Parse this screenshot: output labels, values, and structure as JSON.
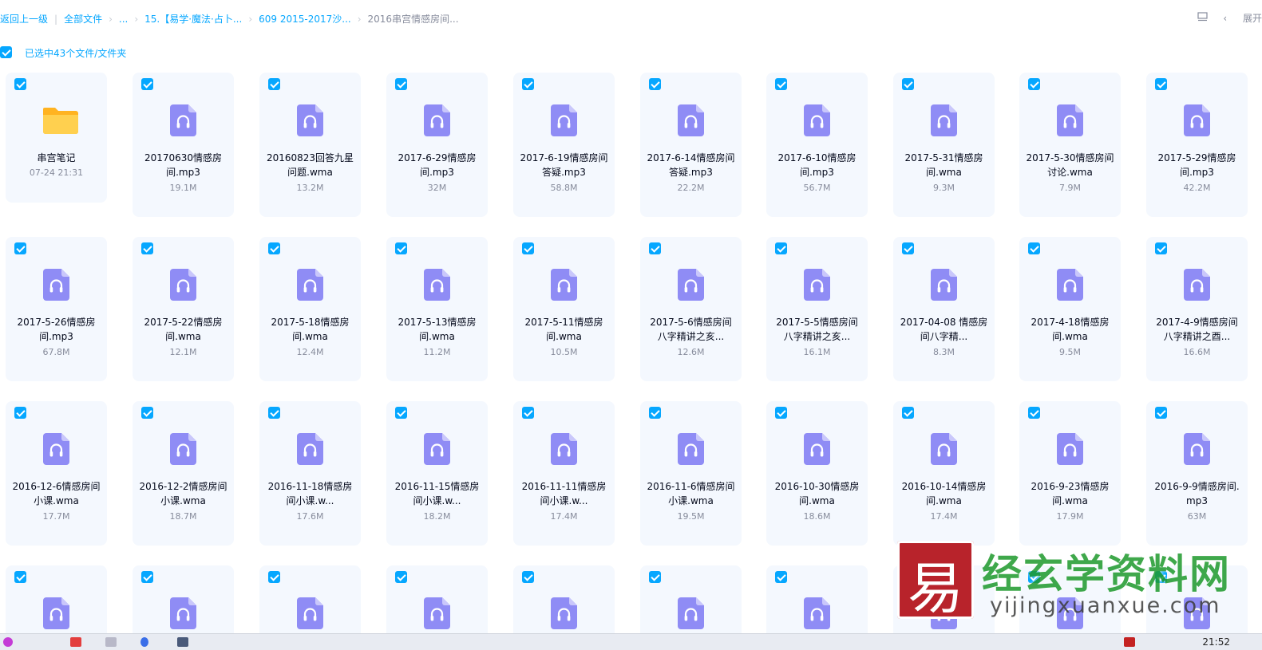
{
  "breadcrumb": {
    "back": "返回上一级",
    "all_files": "全部文件",
    "ellipsis": "...",
    "level1": "15.【易学·魔法·占卜...",
    "level2": "609 2015-2017沙...",
    "current": "2016串宫情感房间..."
  },
  "toolbar": {
    "expand_label": "展开"
  },
  "selection": {
    "label": "已选中43个文件/文件夹"
  },
  "colors": {
    "accent": "#06a7ff",
    "card_bg": "#f4f8fe",
    "audio_icon": "#8f8cf5",
    "folder": "#ffc93d"
  },
  "files": [
    {
      "name": "串宫笔记",
      "meta": "07-24 21:31",
      "type": "folder"
    },
    {
      "name": "20170630情感房间.mp3",
      "meta": "19.1M",
      "type": "audio"
    },
    {
      "name": "20160823回答九星问题.wma",
      "meta": "13.2M",
      "type": "audio"
    },
    {
      "name": "2017-6-29情感房间.mp3",
      "meta": "32M",
      "type": "audio"
    },
    {
      "name": "2017-6-19情感房间答疑.mp3",
      "meta": "58.8M",
      "type": "audio"
    },
    {
      "name": "2017-6-14情感房间答疑.mp3",
      "meta": "22.2M",
      "type": "audio"
    },
    {
      "name": "2017-6-10情感房间.mp3",
      "meta": "56.7M",
      "type": "audio"
    },
    {
      "name": "2017-5-31情感房间.wma",
      "meta": "9.3M",
      "type": "audio"
    },
    {
      "name": "2017-5-30情感房间讨论.wma",
      "meta": "7.9M",
      "type": "audio"
    },
    {
      "name": "2017-5-29情感房间.mp3",
      "meta": "42.2M",
      "type": "audio"
    },
    {
      "name": "2017-5-26情感房间.mp3",
      "meta": "67.8M",
      "type": "audio"
    },
    {
      "name": "2017-5-22情感房间.wma",
      "meta": "12.1M",
      "type": "audio"
    },
    {
      "name": "2017-5-18情感房间.wma",
      "meta": "12.4M",
      "type": "audio"
    },
    {
      "name": "2017-5-13情感房间.wma",
      "meta": "11.2M",
      "type": "audio"
    },
    {
      "name": "2017-5-11情感房间.wma",
      "meta": "10.5M",
      "type": "audio"
    },
    {
      "name": "2017-5-6情感房间八字精讲之亥...",
      "meta": "12.6M",
      "type": "audio"
    },
    {
      "name": "2017-5-5情感房间八字精讲之亥...",
      "meta": "16.1M",
      "type": "audio"
    },
    {
      "name": "2017-04-08 情感房间八字精...",
      "meta": "8.3M",
      "type": "audio"
    },
    {
      "name": "2017-4-18情感房间.wma",
      "meta": "9.5M",
      "type": "audio"
    },
    {
      "name": "2017-4-9情感房间八字精讲之酉...",
      "meta": "16.6M",
      "type": "audio"
    },
    {
      "name": "2016-12-6情感房间小课.wma",
      "meta": "17.7M",
      "type": "audio"
    },
    {
      "name": "2016-12-2情感房间小课.wma",
      "meta": "18.7M",
      "type": "audio"
    },
    {
      "name": "2016-11-18情感房间小课.w...",
      "meta": "17.6M",
      "type": "audio"
    },
    {
      "name": "2016-11-15情感房间小课.w...",
      "meta": "18.2M",
      "type": "audio"
    },
    {
      "name": "2016-11-11情感房间小课.w...",
      "meta": "17.4M",
      "type": "audio"
    },
    {
      "name": "2016-11-6情感房间小课.wma",
      "meta": "19.5M",
      "type": "audio"
    },
    {
      "name": "2016-10-30情感房间.wma",
      "meta": "18.6M",
      "type": "audio"
    },
    {
      "name": "2016-10-14情感房间.wma",
      "meta": "17.4M",
      "type": "audio"
    },
    {
      "name": "2016-9-23情感房间.wma",
      "meta": "17.9M",
      "type": "audio"
    },
    {
      "name": "2016-9-9情感房间.mp3",
      "meta": "63M",
      "type": "audio"
    },
    {
      "name": "",
      "meta": "",
      "type": "audio"
    },
    {
      "name": "",
      "meta": "",
      "type": "audio"
    },
    {
      "name": "",
      "meta": "",
      "type": "audio"
    },
    {
      "name": "",
      "meta": "",
      "type": "audio"
    },
    {
      "name": "",
      "meta": "",
      "type": "audio"
    },
    {
      "name": "",
      "meta": "",
      "type": "audio"
    },
    {
      "name": "",
      "meta": "",
      "type": "audio"
    },
    {
      "name": "",
      "meta": "",
      "type": "audio"
    },
    {
      "name": "",
      "meta": "",
      "type": "audio"
    },
    {
      "name": "",
      "meta": "",
      "type": "audio"
    }
  ],
  "watermark": {
    "logo_char": "易",
    "title": "经玄学资料网",
    "url": "yijingxuanxue.com"
  },
  "taskbar": {
    "time": "21:52"
  }
}
